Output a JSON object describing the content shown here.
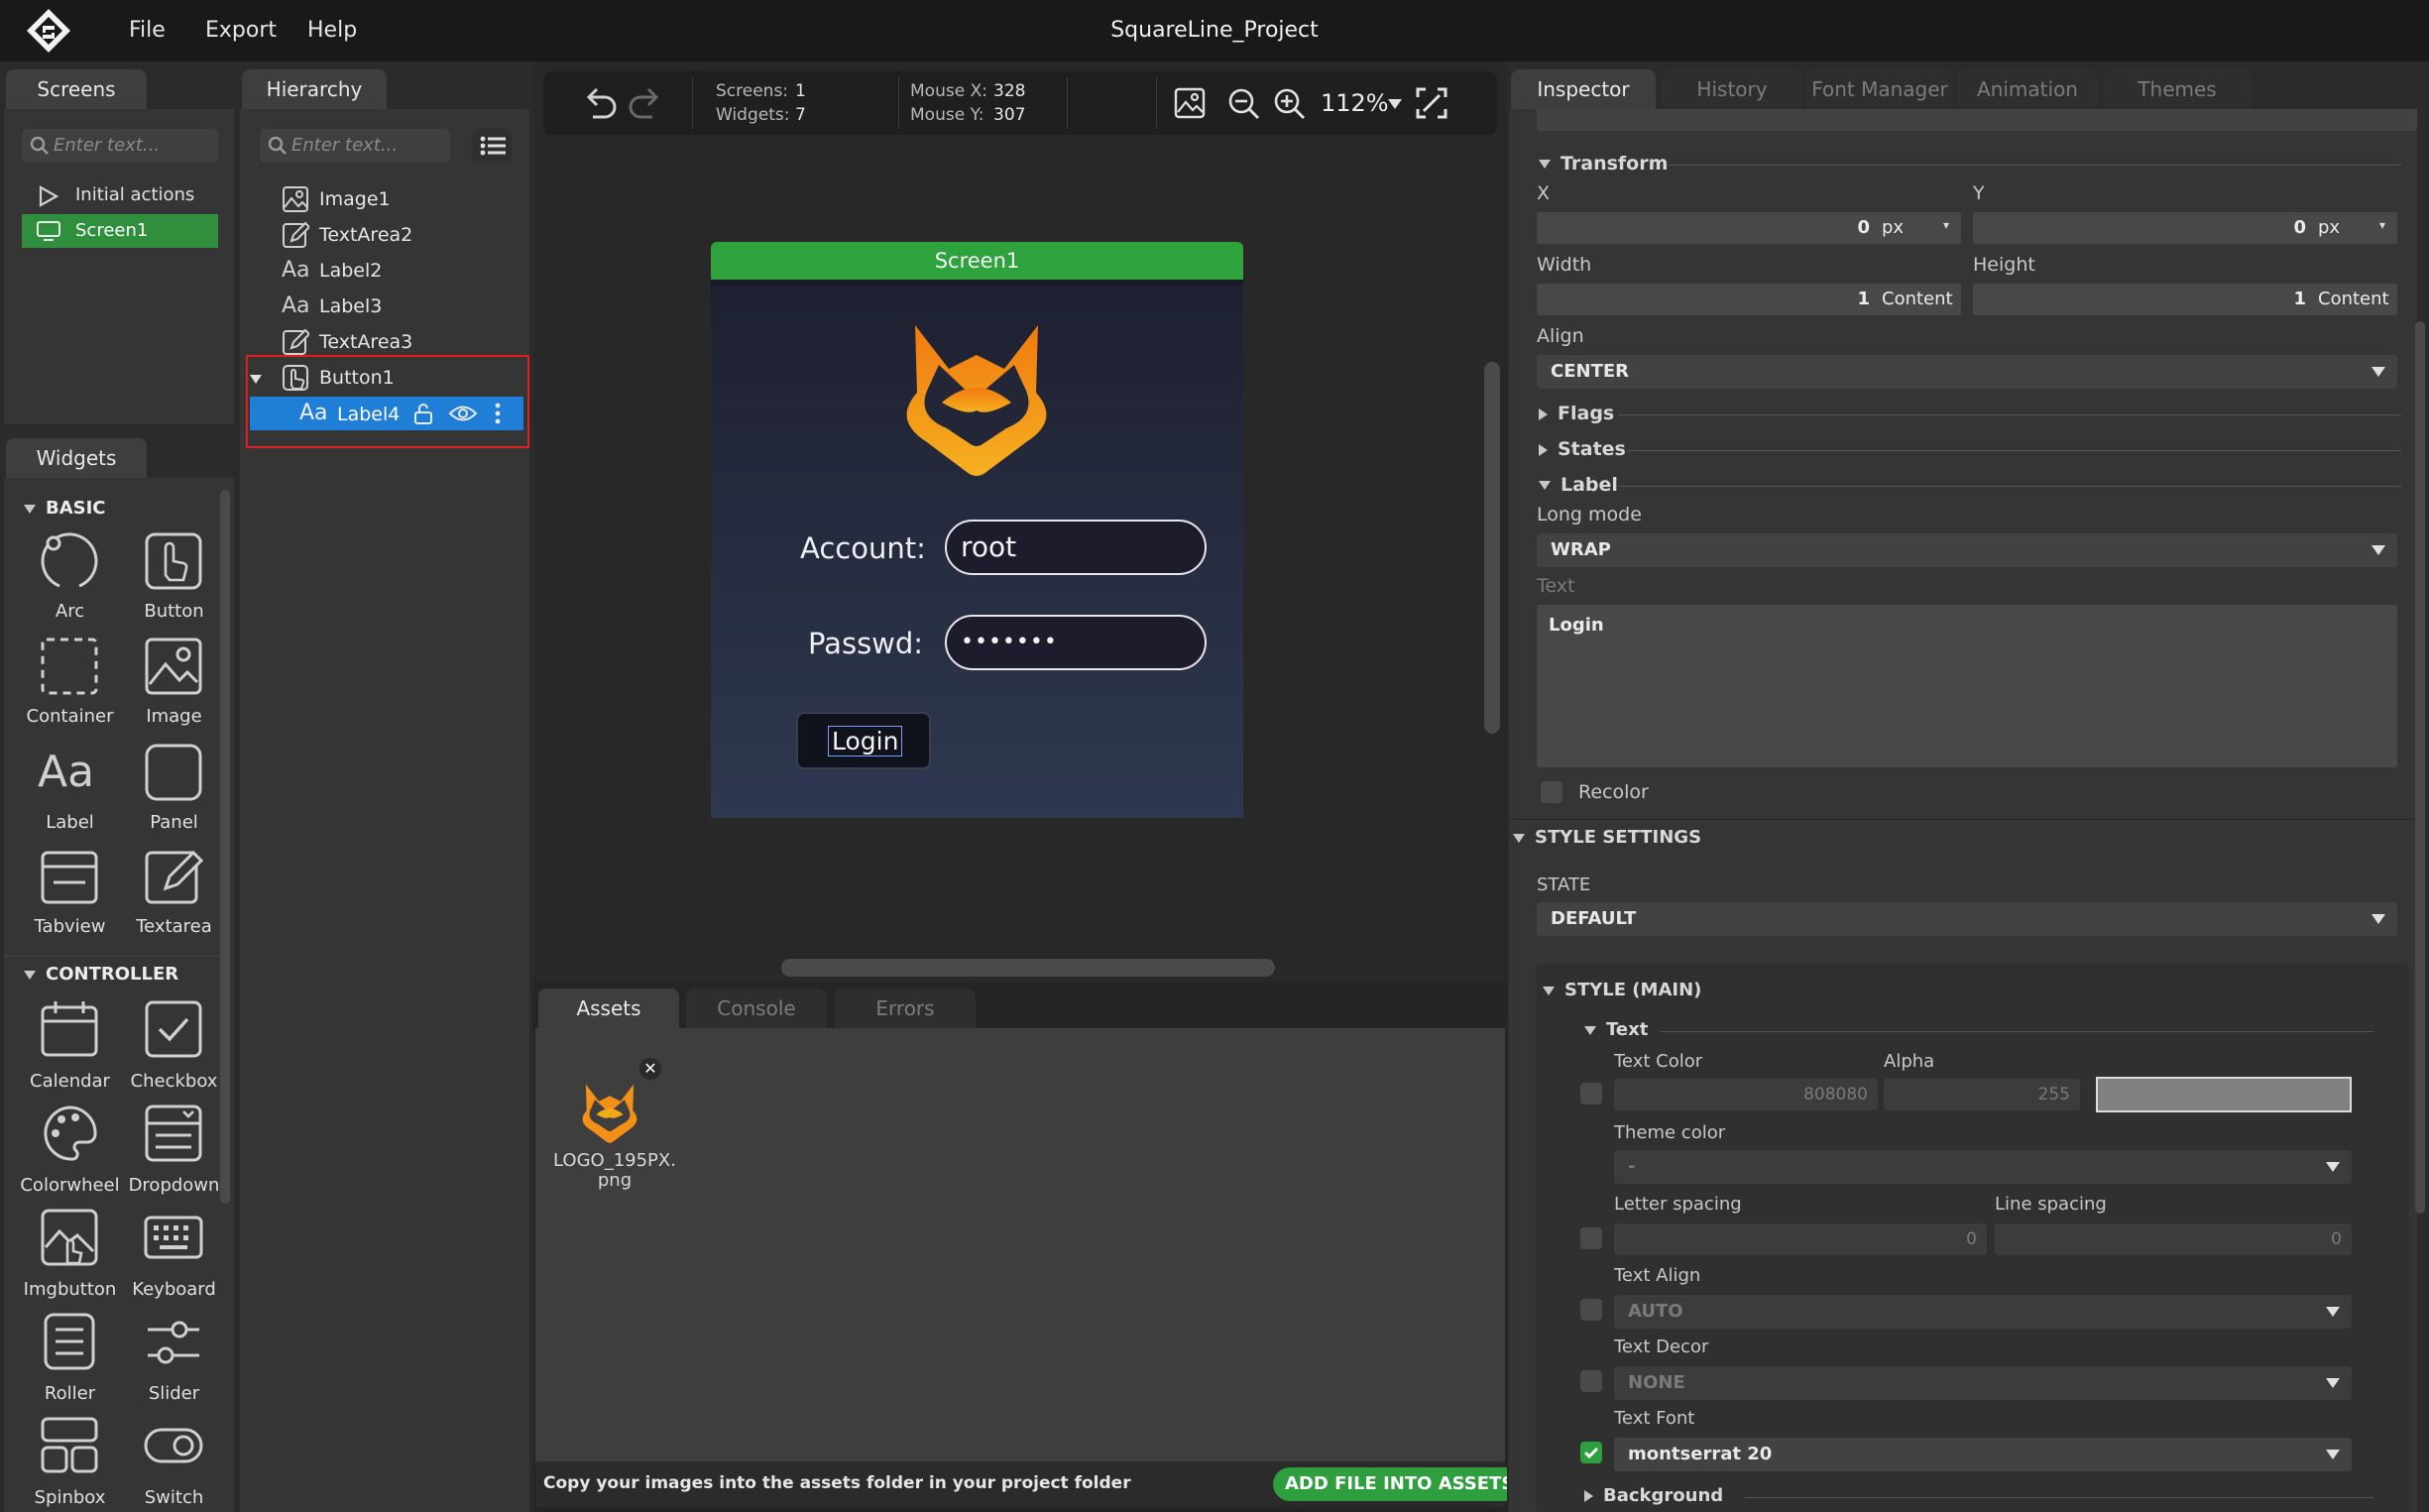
{
  "app": {
    "title": "SquareLine_Project",
    "menu": [
      "File",
      "Export",
      "Help"
    ]
  },
  "screens_panel": {
    "tab": "Screens",
    "search_placeholder": "Enter text...",
    "items": [
      "Initial actions",
      "Screen1"
    ]
  },
  "hierarchy_panel": {
    "tab": "Hierarchy",
    "search_placeholder": "Enter text...",
    "items": [
      "Image1",
      "TextArea2",
      "Label2",
      "Label3",
      "TextArea3",
      "Button1",
      "Label4"
    ]
  },
  "widgets_panel": {
    "tab": "Widgets",
    "basic_title": "BASIC",
    "basic": [
      "Arc",
      "Button",
      "Container",
      "Image",
      "Label",
      "Panel",
      "Tabview",
      "Textarea"
    ],
    "controller_title": "CONTROLLER",
    "controller": [
      "Calendar",
      "Checkbox",
      "Colorwheel",
      "Dropdown",
      "Imgbutton",
      "Keyboard",
      "Roller",
      "Slider",
      "Spinbox",
      "Switch"
    ]
  },
  "toolbar": {
    "screens_label": "Screens:",
    "screens_value": "1",
    "widgets_label": "Widgets:",
    "widgets_value": "7",
    "mouse_x_label": "Mouse X:",
    "mouse_x_value": "328",
    "mouse_y_label": "Mouse Y:",
    "mouse_y_value": "307",
    "zoom": "112%"
  },
  "preview": {
    "screen_name": "Screen1",
    "account_label": "Account:",
    "account_value": "root",
    "passwd_label": "Passwd:",
    "passwd_value": "•••••••",
    "login_button": "Login"
  },
  "bottom_panel": {
    "tabs": [
      "Assets",
      "Console",
      "Errors"
    ],
    "asset_name_line1": "LOGO_195PX.",
    "asset_name_line2": "png",
    "hint": "Copy your images into the assets folder in your project folder",
    "add_button": "ADD FILE INTO ASSETS"
  },
  "inspector": {
    "tabs": [
      "Inspector",
      "History",
      "Font Manager",
      "Animation",
      "Themes"
    ],
    "transform_title": "Transform",
    "x_label": "X",
    "x_value": "0",
    "x_unit": "px",
    "y_label": "Y",
    "y_value": "0",
    "y_unit": "px",
    "width_label": "Width",
    "width_value": "1",
    "width_unit": "Content",
    "height_label": "Height",
    "height_value": "1",
    "height_unit": "Content",
    "align_label": "Align",
    "align_value": "CENTER",
    "flags_title": "Flags",
    "states_title": "States",
    "label_title": "Label",
    "long_mode_label": "Long mode",
    "long_mode_value": "WRAP",
    "text_label": "Text",
    "text_value": "Login",
    "recolor_label": "Recolor",
    "style_settings_title": "STYLE SETTINGS",
    "state_label": "STATE",
    "state_value": "DEFAULT",
    "style_main_title": "STYLE (MAIN)",
    "text_section_title": "Text",
    "text_color_label": "Text Color",
    "text_color_value": "808080",
    "alpha_label": "Alpha",
    "alpha_value": "255",
    "swatch_color": "#808080",
    "theme_color_label": "Theme color",
    "theme_color_value": "-",
    "letter_spacing_label": "Letter spacing",
    "letter_spacing_value": "0",
    "line_spacing_label": "Line spacing",
    "line_spacing_value": "0",
    "text_align_label": "Text Align",
    "text_align_value": "AUTO",
    "text_decor_label": "Text Decor",
    "text_decor_value": "NONE",
    "text_font_label": "Text Font",
    "text_font_value": "montserrat 20",
    "background_title": "Background"
  },
  "colors": {
    "accent_green": "#2e9e3e",
    "selection_blue": "#1f7fd6",
    "highlight_red": "#e02020",
    "logo_orange": "#f59a10"
  }
}
